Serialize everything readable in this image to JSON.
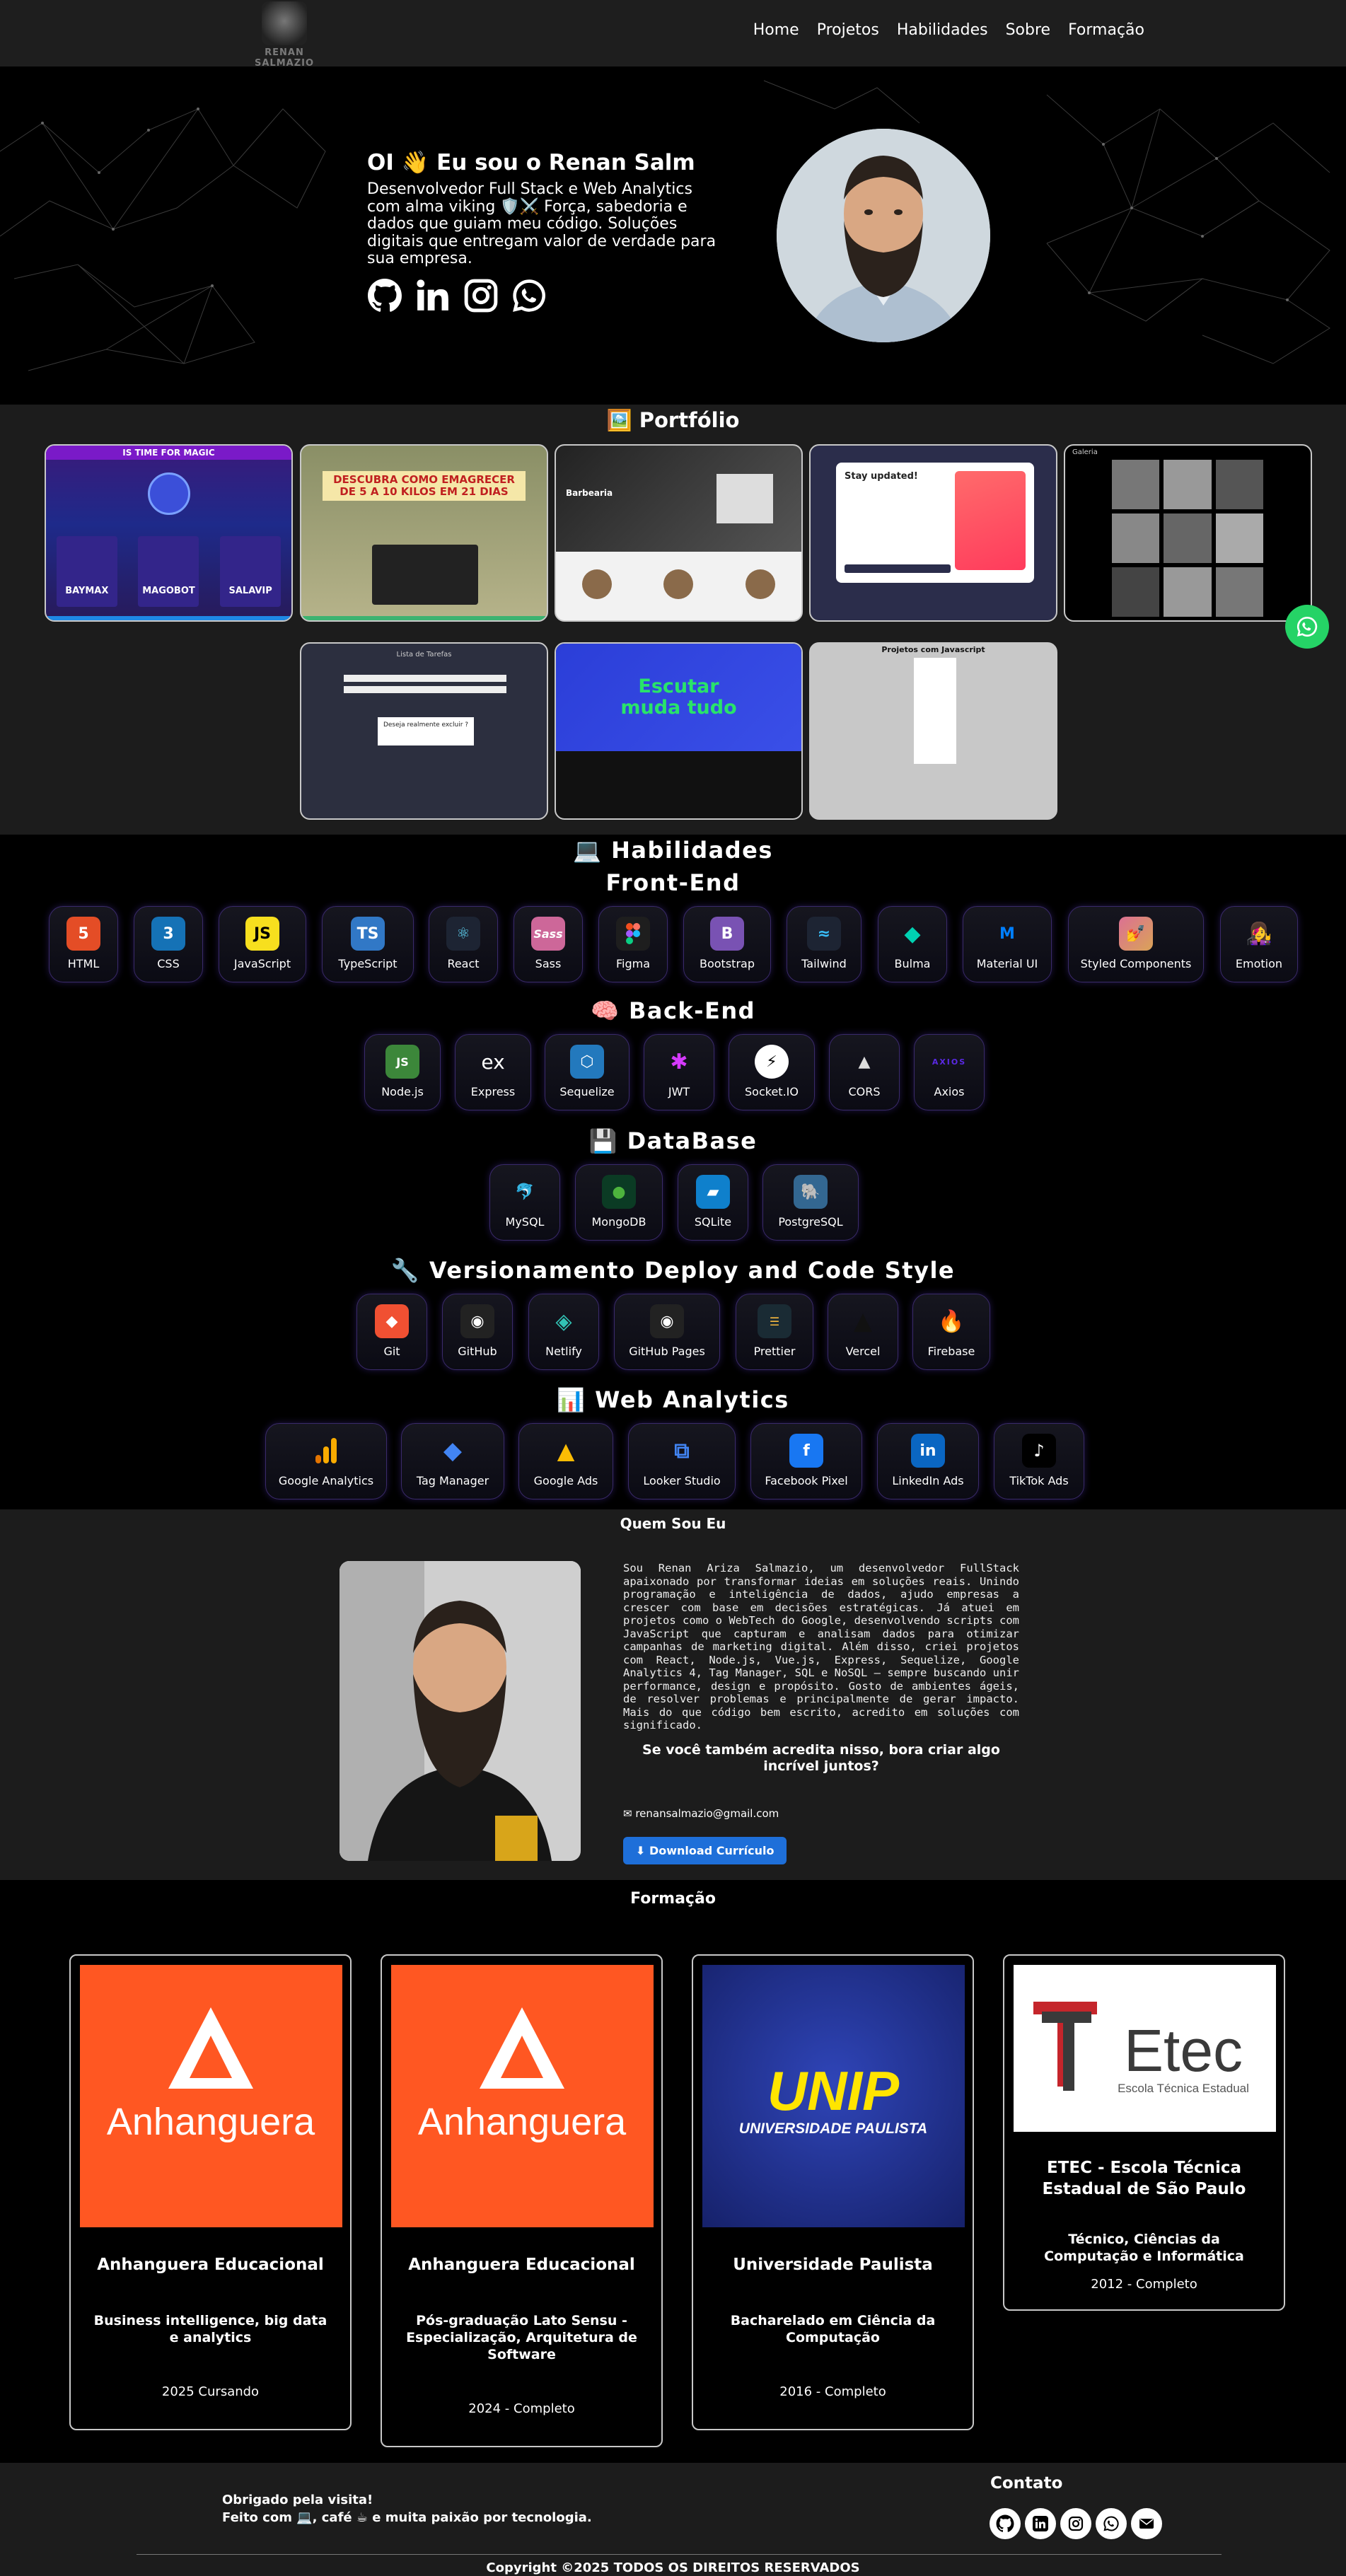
{
  "nav": {
    "logo_text": "RENAN SALMAZIO",
    "items": [
      "Home",
      "Projetos",
      "Habilidades",
      "Sobre",
      "Formação"
    ]
  },
  "hero": {
    "title": "OI 👋 Eu sou o Renan Salm",
    "description": "Desenvolvedor Full Stack e Web Analytics com alma viking 🛡️⚔️ Força, sabedoria e dados que guiam meu código. Soluções digitais que entregam valor de verdade para sua empresa.",
    "socials": [
      "github-icon",
      "linkedin-icon",
      "instagram-icon",
      "whatsapp-icon"
    ]
  },
  "portfolio": {
    "title": "🖼️ Portfólio",
    "cards": [
      {
        "label": "IS TIME FOR MAGIC",
        "sub": [
          "BAYMAX",
          "MAGOBOT",
          "SALAVIP"
        ]
      },
      {
        "label": "DESCUBRA COMO EMAGRECER DE 5 A 10 KILOS EM 21 DIAS"
      },
      {
        "label": "Barbearia"
      },
      {
        "label": "Stay updated!"
      },
      {
        "label": "Galeria"
      },
      {
        "label": "Lista de Tarefas",
        "sub": [
          "Deseja realmente excluir ?"
        ]
      },
      {
        "label": "Escutar muda tudo"
      },
      {
        "label": "Projetos com Javascript"
      }
    ]
  },
  "skills": {
    "title": "💻 Habilidades",
    "frontend": {
      "title": "Front-End",
      "items": [
        "HTML",
        "CSS",
        "JavaScript",
        "TypeScript",
        "React",
        "Sass",
        "Figma",
        "Bootstrap",
        "Tailwind",
        "Bulma",
        "Material UI",
        "Styled Components",
        "Emotion"
      ]
    },
    "backend": {
      "title": "🧠 Back-End",
      "items": [
        "Node.js",
        "Express",
        "Sequelize",
        "JWT",
        "Socket.IO",
        "CORS",
        "Axios"
      ]
    },
    "database": {
      "title": "💾 DataBase",
      "items": [
        "MySQL",
        "MongoDB",
        "SQLite",
        "PostgreSQL"
      ]
    },
    "versioning": {
      "title": "🔧 Versionamento Deploy and Code Style",
      "items": [
        "Git",
        "GitHub",
        "Netlify",
        "GitHub Pages",
        "Prettier",
        "Vercel",
        "Firebase"
      ]
    },
    "analytics": {
      "title": "📊 Web Analytics",
      "items": [
        "Google Analytics",
        "Tag Manager",
        "Google Ads",
        "Looker Studio",
        "Facebook Pixel",
        "LinkedIn Ads",
        "TikTok Ads"
      ]
    }
  },
  "about": {
    "title": "Quem Sou Eu",
    "bio": "Sou Renan Ariza Salmazio, um desenvolvedor FullStack apaixonado por transformar ideias em soluções reais. Unindo programação e inteligência de dados, ajudo empresas a crescer com base em decisões estratégicas. Já atuei em projetos como o WebTech do Google, desenvolvendo scripts com JavaScript que capturam e analisam dados para otimizar campanhas de marketing digital. Além disso, criei projetos com React, Node.js, Vue.js, Express, Sequelize, Google Analytics 4, Tag Manager, SQL e NoSQL — sempre buscando unir performance, design e propósito. Gosto de ambientes ágeis, de resolver problemas e principalmente de gerar impacto. Mais do que código bem escrito, acredito em soluções com significado.",
    "cta": "Se você também acredita nisso, bora criar algo incrível juntos?",
    "email": "renansalmazio@gmail.com",
    "button": "Download Currículo"
  },
  "formacao": {
    "title": "Formação",
    "cards": [
      {
        "logo": "Anhanguera",
        "name": "Anhanguera Educacional",
        "course": "Business intelligence, big data e analytics",
        "year": "2025 Cursando"
      },
      {
        "logo": "Anhanguera",
        "name": "Anhanguera Educacional",
        "course": "Pós-graduação Lato Sensu - Especialização, Arquitetura de Software",
        "year": "2024 - Completo"
      },
      {
        "logo": "UNIP",
        "logo_sub": "UNIVERSIDADE PAULISTA",
        "name": "Universidade Paulista",
        "course": "Bacharelado em Ciência da Computação",
        "year": "2016 - Completo"
      },
      {
        "logo": "Etec",
        "logo_sub": "Escola Técnica Estadual",
        "name": "ETEC - Escola Técnica Estadual de São Paulo",
        "course": "Técnico, Ciências da Computação e Informática",
        "year": "2012 - Completo"
      }
    ]
  },
  "footer": {
    "thanks_line1": "Obrigado pela visita!",
    "thanks_line2": "Feito com 💻, café ☕ e muita paixão por tecnologia.",
    "contact_title": "Contato",
    "copyright": "Copyright ©2025 TODOS OS DIREITOS RESERVADOS"
  },
  "colors": {
    "accent": "#1e6fd9",
    "whatsapp": "#25d366",
    "anhanguera": "#ff5722",
    "unip_blue": "#1f2f8a",
    "unip_yellow": "#ffe500"
  }
}
